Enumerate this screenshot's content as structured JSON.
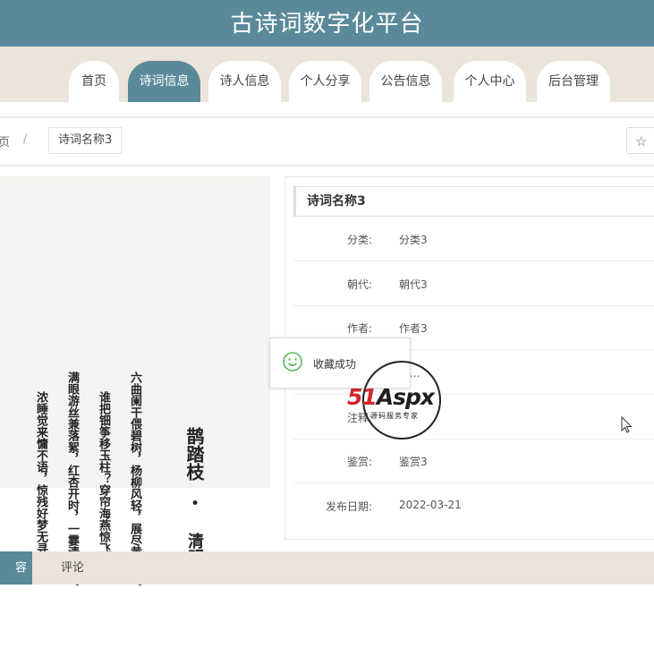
{
  "header": {
    "title": "古诗词数字化平台"
  },
  "nav": [
    {
      "label": "首页"
    },
    {
      "label": "诗词信息",
      "active": true
    },
    {
      "label": "诗人信息"
    },
    {
      "label": "个人分享"
    },
    {
      "label": "公告信息"
    },
    {
      "label": "个人中心"
    },
    {
      "label": "后台管理"
    }
  ],
  "breadcrumb": {
    "home": "页",
    "separator": "/",
    "current": "诗词名称3",
    "favorite_icon": "star-outline-icon",
    "favorite_label": ""
  },
  "poem_image": {
    "columns": [
      "鹊踏枝",
      "•",
      "清明",
      "六曲阑干偎碧树，杨柳风轻，展尽黄金缕。",
      "谁把钿筝移玉柱？穿帘海燕惊飞去。",
      "满眼游丝兼落絮，红杏开时，一霎清明雨。",
      "浓睡觉来慵不语，惊残好梦无寻处？"
    ]
  },
  "details": {
    "title": "诗词名称3",
    "rows": [
      {
        "label": "分类:",
        "value": "分类3"
      },
      {
        "label": "朝代:",
        "value": "朝代3"
      },
      {
        "label": "作者:",
        "value": "作者3"
      },
      {
        "label": "",
        "value": "文..."
      },
      {
        "label": "注释:",
        "value": ""
      },
      {
        "label": "鉴赏:",
        "value": "鉴赏3"
      },
      {
        "label": "发布日期:",
        "value": "2022-03-21"
      }
    ]
  },
  "toast": {
    "icon": "smile-icon",
    "message": "收藏成功"
  },
  "watermark": {
    "brand_a": "51",
    "brand_b": "Aspx",
    "tagline": "源码服务专家"
  },
  "bottom_tabs": [
    {
      "label": "容"
    },
    {
      "label": "评论"
    }
  ],
  "colors": {
    "primary": "#5a8a99",
    "nav_bg": "#ebe4da",
    "watermark_red": "#d0262b",
    "watermark_green": "#2e9e44"
  }
}
